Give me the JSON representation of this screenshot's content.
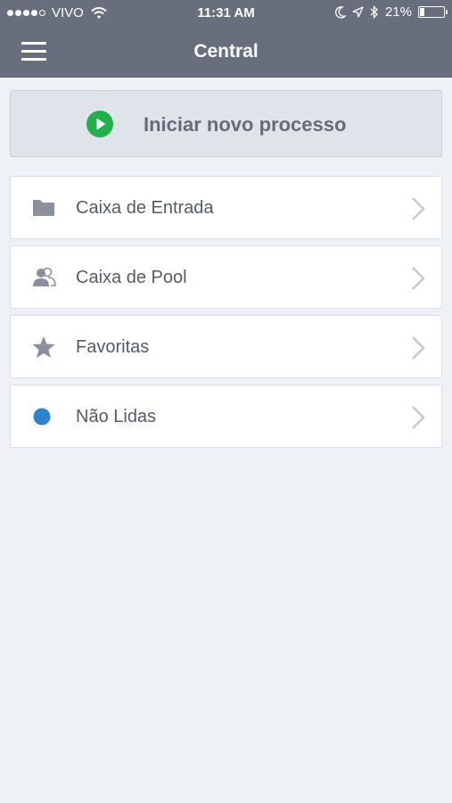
{
  "status_bar": {
    "carrier": "VIVO",
    "time": "11:31 AM",
    "battery_percent": "21%",
    "battery_level": 0.21,
    "signal_icon": "signal-dots-icon",
    "wifi_icon": "wifi-icon",
    "moon_icon": "moon-icon",
    "location_icon": "location-arrow-icon",
    "bluetooth_icon": "bluetooth-icon"
  },
  "navbar": {
    "title": "Central",
    "menu_icon": "hamburger-menu-icon",
    "bg_color": "#686e7c"
  },
  "start_button": {
    "label": "Iniciar novo processo",
    "icon": "play-circle-icon",
    "icon_color": "#21b14a"
  },
  "menu": {
    "items": [
      {
        "label": "Caixa de Entrada",
        "icon": "folder-icon"
      },
      {
        "label": "Caixa de Pool",
        "icon": "users-icon"
      },
      {
        "label": "Favoritas",
        "icon": "star-icon"
      },
      {
        "label": "Não Lidas",
        "icon": "unread-dot-icon",
        "icon_color": "#2a84d2"
      }
    ]
  },
  "colors": {
    "background": "#eef1f6",
    "icon_gray": "#8a909c",
    "chevron": "#c6c9cf"
  }
}
